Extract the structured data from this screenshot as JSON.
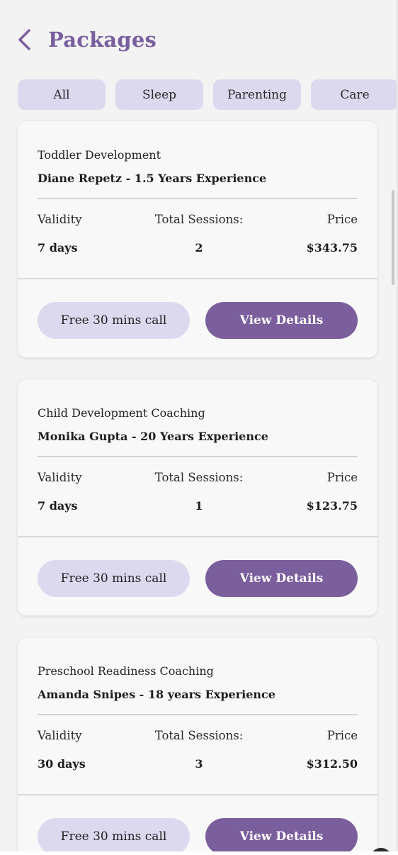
{
  "header": {
    "title": "Packages"
  },
  "tabs": [
    {
      "label": "All"
    },
    {
      "label": "Sleep"
    },
    {
      "label": "Parenting"
    },
    {
      "label": "Care"
    }
  ],
  "labels": {
    "validity": "Validity",
    "sessions": "Total Sessions:",
    "price": "Price",
    "free_call": "Free 30 mins call",
    "view_details": "View Details"
  },
  "packages": [
    {
      "category": "Toddler Development",
      "coach": "Diane Repetz - 1.5 Years Experience",
      "validity": "7 days",
      "sessions": "2",
      "price": "$343.75"
    },
    {
      "category": "Child Development Coaching",
      "coach": "Monika Gupta  - 20 Years Experience",
      "validity": "7 days",
      "sessions": "1",
      "price": "$123.75"
    },
    {
      "category": "Preschool Readiness Coaching",
      "coach": "Amanda Snipes - 18 years Experience",
      "validity": "30 days",
      "sessions": "3",
      "price": "$312.50"
    }
  ],
  "colors": {
    "brand": "#7b5e9c",
    "chip": "#dcd9ef",
    "background": "#f3f3f3"
  },
  "icons": {
    "back": "chevron-left-icon"
  }
}
